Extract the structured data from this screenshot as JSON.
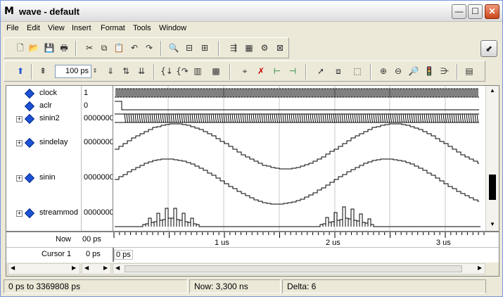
{
  "window": {
    "title": "wave - default",
    "logo": "M",
    "controls": {
      "minimize": "—",
      "maximize": "☐",
      "close": "✕"
    }
  },
  "menu": [
    "File",
    "Edit",
    "View",
    "Insert",
    "Format",
    "Tools",
    "Window"
  ],
  "toolbar": {
    "zoom_value": "100 ps"
  },
  "signals": [
    {
      "name": "clock",
      "value": "1",
      "expandable": false
    },
    {
      "name": "aclr",
      "value": "0",
      "expandable": false
    },
    {
      "name": "sinin2",
      "value": "0000000",
      "expandable": true
    },
    {
      "name": "sindelay",
      "value": "0000000",
      "expandable": true
    },
    {
      "name": "sinin",
      "value": "0000000",
      "expandable": true
    },
    {
      "name": "streammod",
      "value": "0000000",
      "expandable": true
    }
  ],
  "timeline": {
    "now_label": "Now",
    "now_value": "00 ps",
    "cursor_label": "Cursor 1",
    "cursor_value": "0 ps",
    "cursor_marker": "0 ps",
    "ticks": [
      "1 us",
      "2 us",
      "3 us"
    ]
  },
  "status": {
    "range": "0 ps to 3369808 ps",
    "now": "Now: 3,300 ns",
    "delta": "Delta: 6"
  },
  "colors": {
    "signal_diamond": "#1c52d6",
    "wave_line": "#000000"
  }
}
